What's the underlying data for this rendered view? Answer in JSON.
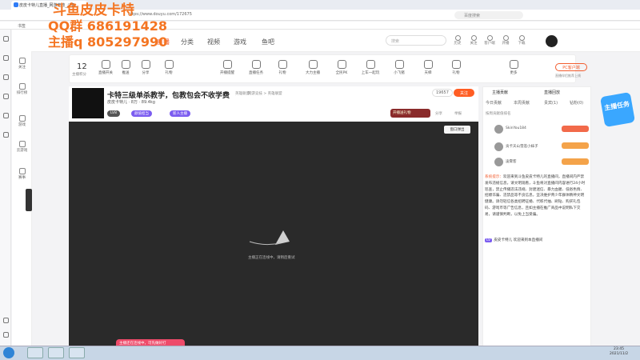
{
  "browser": {
    "tab_title": "皮皮卡特儿直播_网游竞技_斗鱼...",
    "url": "https://www.douyu.com/172675",
    "side_search_placeholder": "百度搜索",
    "bookmark_label": "书签"
  },
  "watermark": {
    "line1": "斗鱼皮皮卡特",
    "line2": "QQ群 686191428",
    "line3": "主播q 805297990"
  },
  "header": {
    "nav": [
      "直播",
      "分类",
      "视频",
      "游戏",
      "鱼吧"
    ],
    "search_placeholder": "搜索",
    "icons": [
      "历史",
      "关注",
      "客户端",
      "开播",
      "下载"
    ]
  },
  "leftnav": [
    "关注",
    "排行榜",
    "游戏",
    "云游戏",
    "赛事"
  ],
  "toolbar": {
    "level": "12",
    "level_sub": "主播积分",
    "items": [
      "直播开关",
      "推送",
      "分享",
      "礼物",
      "开播提醒",
      "直播任务",
      "礼物",
      "大力主播",
      "全民PK",
      "上车一起玩",
      "小飞猪",
      "天梯",
      "礼物",
      "更多"
    ],
    "pc_button": "PC客户端",
    "pc_sub": "直播伴侣推荐上线"
  },
  "room": {
    "title": "卡特三级单杀教学，包教包会不收学费",
    "category": "英雄联盟",
    "meta": "网游竞技 > 英雄联盟",
    "anchor_name": "皮皮卡特儿",
    "followers": "8万",
    "weight": "89.4kg",
    "hot": "19657",
    "follow_label": "关注",
    "gift_label": "开播送礼物",
    "share": "分享",
    "report": "举报",
    "tags": [
      "LV8",
      "颜值担当",
      "新人主播"
    ]
  },
  "player": {
    "popout": "窗口弹出",
    "offline_text": "主播正在连线中，请稍后重试",
    "bottom_tip": "主播还在连线中，可先做好打"
  },
  "chat": {
    "head_left": "主播贡献",
    "head_right": "直播回放",
    "tabs": [
      "今日贡献",
      "本周贡献",
      "贵宾(1)",
      "钻粉(0)"
    ],
    "rank_hint": "按周贡献值排名",
    "ranks": [
      "SkinYou184",
      "贡卡天山雪莲小妹子",
      "凌霄客"
    ],
    "sys_tag": "系统提示：",
    "sys_text": "欢迎来到斗鱼皮皮卡特儿的直播间，直播间内严禁发布违规信息，请文明观看，斗鱼将对直播间内容进行24小时巡查，禁止传播违法违规、封建迷信、暴力血腥、低俗色情、招嫖诈骗、违禁品等不良信息，坚决维护青少年群体精神文明健康。请勿轻信各类招聘征婚、代练代抽、刷钻、购买礼包码、游戏币等广告信息，且如主播在推广商品中说明私下交易，请谨慎判断，以免上当受骗。",
    "welcome_level": "LV",
    "welcome_text": "皮皮卡特儿 欢迎来到本直播间"
  },
  "float_badge": "主播任务",
  "taskbar": {
    "time": "23:45",
    "date": "2021/11/2"
  }
}
